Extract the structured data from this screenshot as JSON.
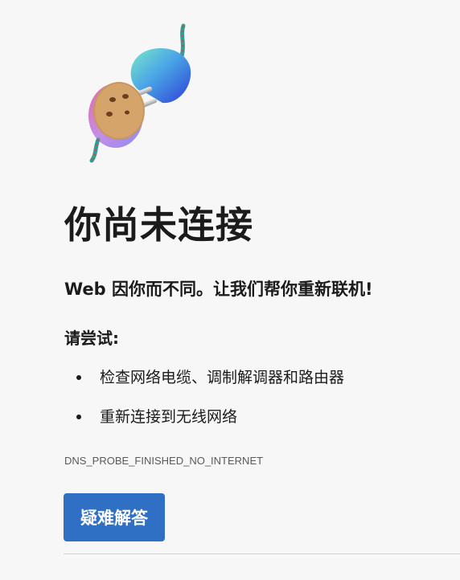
{
  "page": {
    "title": "你尚未连接",
    "subtitle": "Web 因你而不同。让我们帮你重新联机!",
    "try_label": "请尝试:",
    "suggestions": [
      "检查网络电缆、调制解调器和路由器",
      "重新连接到无线网络"
    ],
    "error_code": "DNS_PROBE_FINISHED_NO_INTERNET",
    "troubleshoot_label": "疑难解答"
  },
  "colors": {
    "background": "#f7f7f7",
    "button": "#2f6fc4",
    "button_text": "#ffffff",
    "error_code_text": "#5a5a5a"
  },
  "icons": {
    "illustration": "unplugged-cable-icon"
  }
}
